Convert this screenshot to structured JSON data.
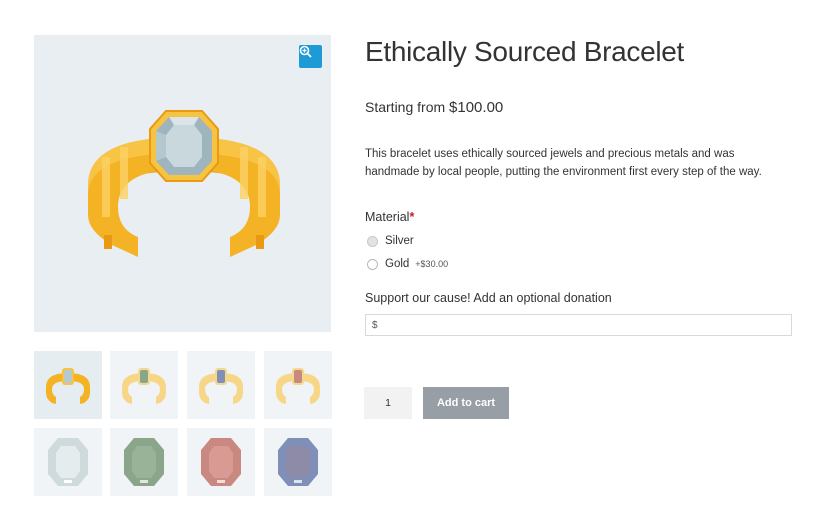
{
  "product": {
    "title": "Ethically Sourced Bracelet",
    "price_prefix": "Starting from",
    "price": "$100.00",
    "description": "This bracelet uses ethically sourced jewels and precious metals and was handmade by local people, putting the environment first every step of the way."
  },
  "gallery": {
    "zoom_icon": "zoom-in-icon",
    "thumbnails": [
      {
        "name": "bracelet-silver-gem",
        "gem_color": "#b7c8cf",
        "active": true
      },
      {
        "name": "bracelet-green-gem",
        "gem_color": "#8aa58a"
      },
      {
        "name": "bracelet-blue-gem",
        "gem_color": "#7f8fb8"
      },
      {
        "name": "bracelet-red-gem",
        "gem_color": "#c98880"
      },
      {
        "name": "gem-silver",
        "gem_color": "#cfdadd"
      },
      {
        "name": "gem-green",
        "gem_color": "#8aa58a"
      },
      {
        "name": "gem-red",
        "gem_color": "#c98880"
      },
      {
        "name": "gem-blue",
        "gem_color": "#7f8fb8"
      }
    ]
  },
  "options": {
    "material_label": "Material",
    "required_mark": "*",
    "materials": [
      {
        "label": "Silver",
        "addon": "",
        "selected": true
      },
      {
        "label": "Gold",
        "addon": "+$30.00",
        "selected": false
      }
    ],
    "donation_label": "Support our cause! Add an optional donation",
    "donation_prefix": "$"
  },
  "cart": {
    "quantity": "1",
    "add_to_cart_label": "Add to cart"
  },
  "colors": {
    "gold": "#f4b324",
    "gold_dark": "#e89a12",
    "gold_light": "#fbd163",
    "accent": "#1e9bd7",
    "button": "#979ea5"
  }
}
